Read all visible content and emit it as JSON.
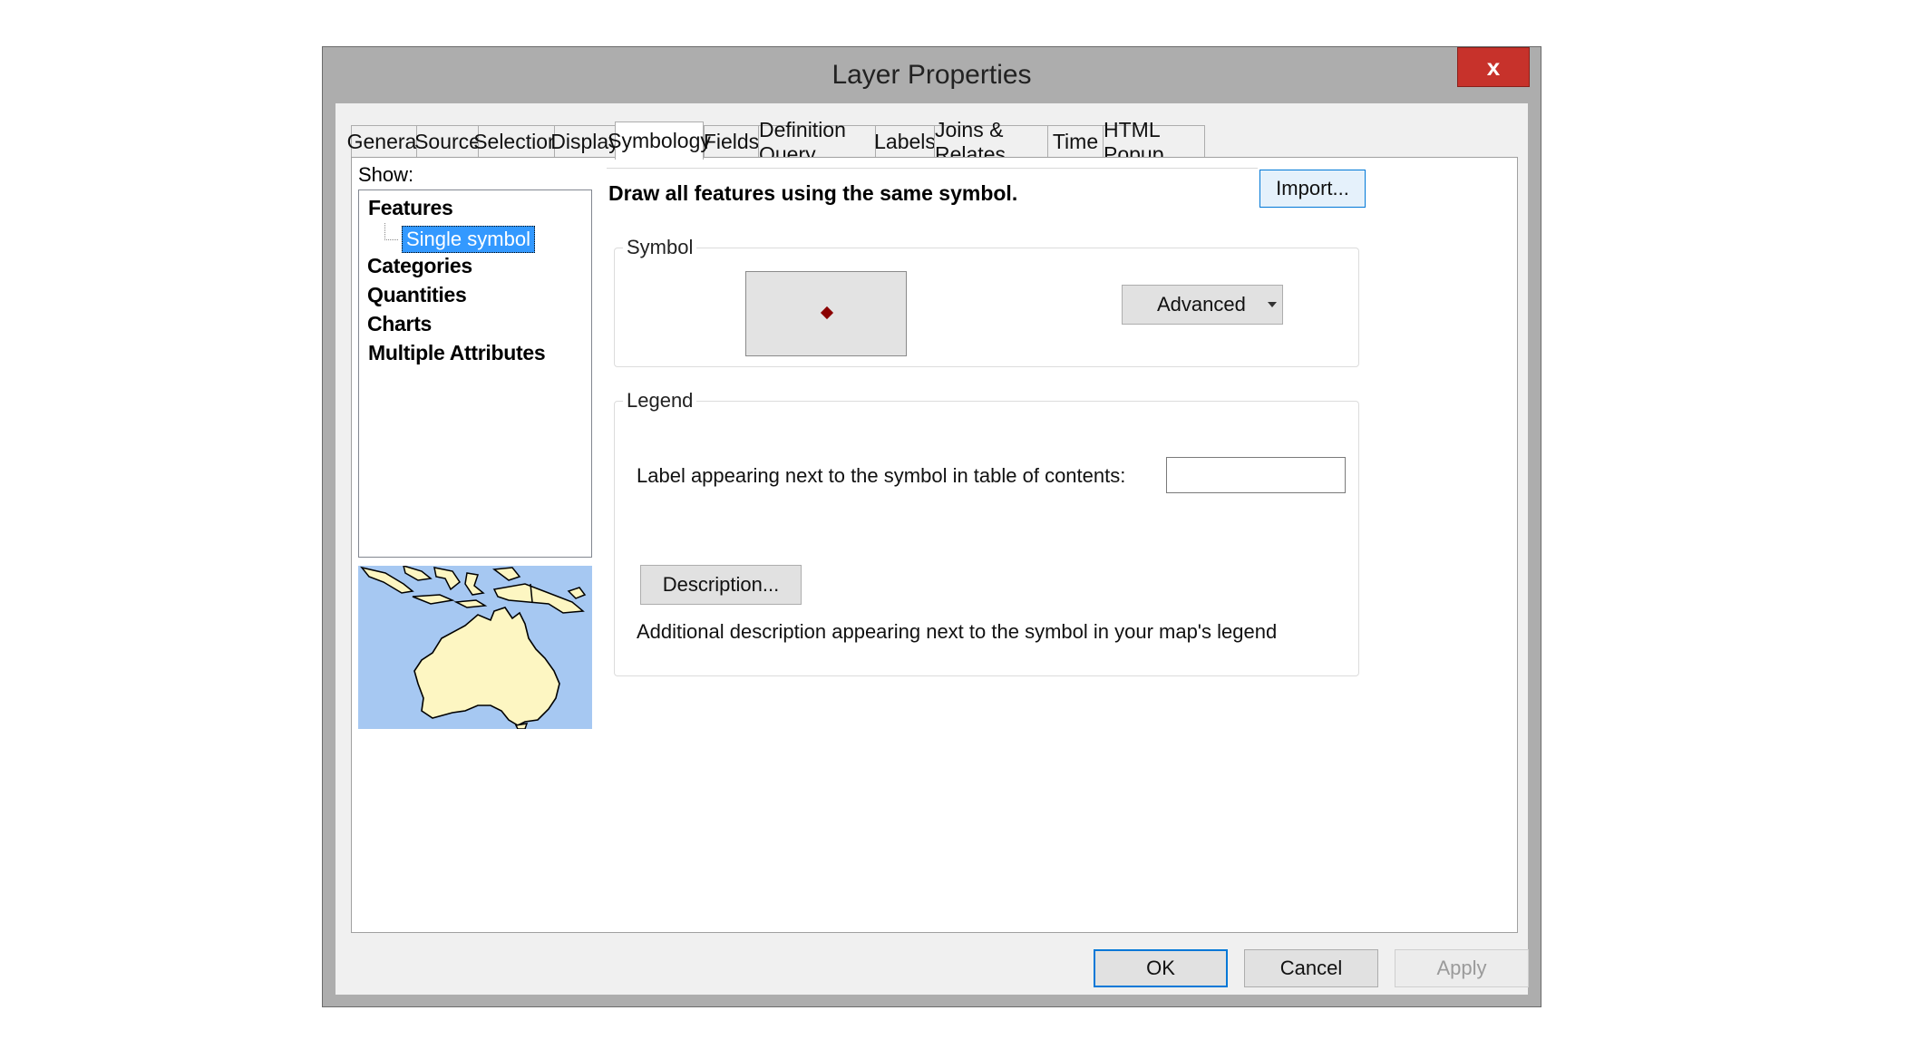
{
  "window": {
    "title": "Layer Properties",
    "close_label": "x"
  },
  "tabs": [
    {
      "label": "General"
    },
    {
      "label": "Source"
    },
    {
      "label": "Selection"
    },
    {
      "label": "Display"
    },
    {
      "label": "Symbology",
      "active": true
    },
    {
      "label": "Fields"
    },
    {
      "label": "Definition Query"
    },
    {
      "label": "Labels"
    },
    {
      "label": "Joins & Relates"
    },
    {
      "label": "Time"
    },
    {
      "label": "HTML Popup"
    }
  ],
  "show": {
    "label": "Show:",
    "items": [
      "Features",
      "Single symbol",
      "Categories",
      "Quantities",
      "Charts",
      "Multiple Attributes"
    ],
    "selected": "Single symbol"
  },
  "main": {
    "description": "Draw all features using the same symbol.",
    "import_label": "Import...",
    "symbol": {
      "title": "Symbol",
      "advanced_label": "Advanced"
    },
    "legend": {
      "title": "Legend",
      "label_prompt": "Label appearing next to the symbol in table of contents:",
      "label_value": "",
      "description_button": "Description...",
      "description_text": "Additional description appearing next to the symbol in your map's legend"
    }
  },
  "buttons": {
    "ok": "OK",
    "cancel": "Cancel",
    "apply": "Apply"
  },
  "colors": {
    "selection": "#3399ff",
    "close": "#c7322b",
    "map_water": "#a6c8f2",
    "map_land": "#fdf6c2",
    "symbol": "#8b0000"
  }
}
